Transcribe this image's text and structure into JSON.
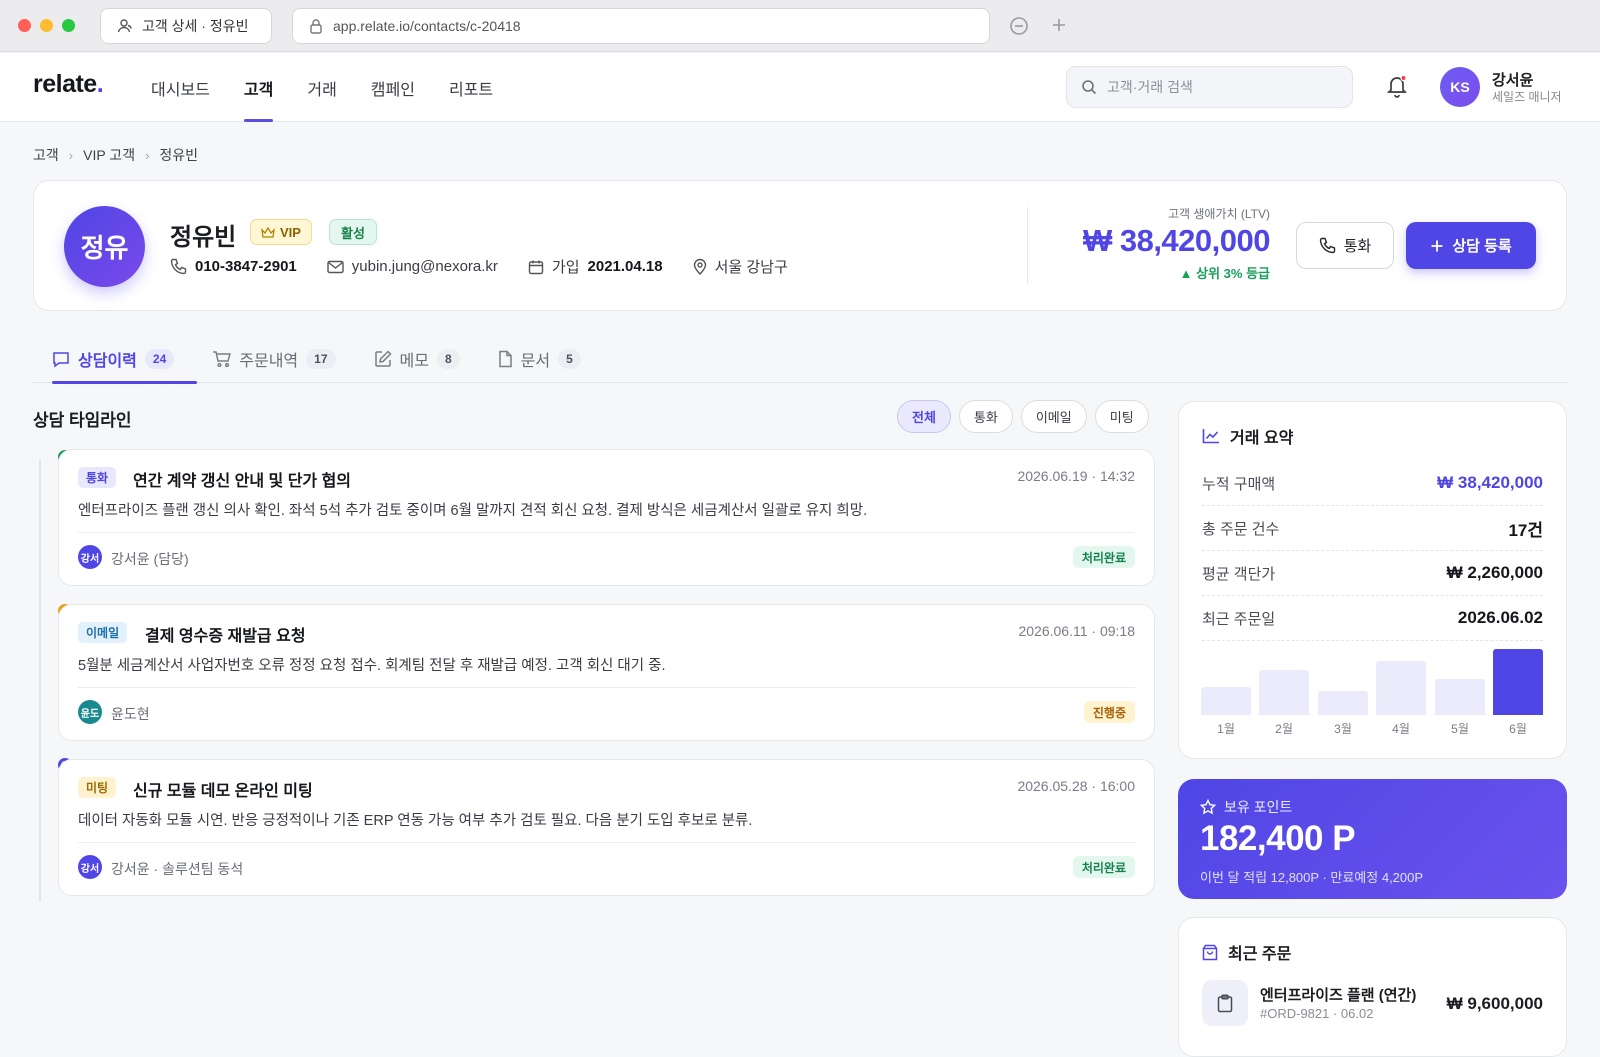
{
  "browser": {
    "tab_title": "고객 상세 · 정유빈",
    "url": "app.relate.io/contacts/c-20418"
  },
  "header": {
    "logo": "relate",
    "logo_dot": ".",
    "nav": [
      "대시보드",
      "고객",
      "거래",
      "캠페인",
      "리포트"
    ],
    "active_nav": "고객",
    "search_placeholder": "고객·거래 검색",
    "user": {
      "initials": "KS",
      "name": "강서윤",
      "role": "세일즈 매니저"
    }
  },
  "breadcrumb": [
    "고객",
    "VIP 고객",
    "정유빈"
  ],
  "profile": {
    "avatar": "정유",
    "name": "정유빈",
    "vip_badge": "VIP",
    "status_badge": "활성",
    "phone": "010-3847-2901",
    "email": "yubin.jung@nexora.kr",
    "join_label": "가입",
    "join_date": "2021.04.18",
    "location": "서울 강남구",
    "ltv_label": "고객 생애가치 (LTV)",
    "ltv_value": "₩ 38,420,000",
    "ltv_rank": "▲ 상위 3% 등급",
    "call_button": "통화",
    "add_button": "상담 등록"
  },
  "tabs": [
    {
      "label": "상담이력",
      "count": "24"
    },
    {
      "label": "주문내역",
      "count": "17"
    },
    {
      "label": "메모",
      "count": "8"
    },
    {
      "label": "문서",
      "count": "5"
    }
  ],
  "timeline": {
    "title": "상담 타임라인",
    "filters": [
      "전체",
      "통화",
      "이메일",
      "미팅"
    ],
    "entries": [
      {
        "type": "통화",
        "title": "연간 계약 갱신 안내 및 단가 협의",
        "date": "2026.06.19 · 14:32",
        "body": "엔터프라이즈 플랜 갱신 의사 확인. 좌석 5석 추가 검토 중이며 6월 말까지 견적 회신 요청. 결제 방식은 세금계산서 일괄로 유지 희망.",
        "avatar": "강서",
        "who": "강서윤 (담당)",
        "status": "처리완료"
      },
      {
        "type": "이메일",
        "title": "결제 영수증 재발급 요청",
        "date": "2026.06.11 · 09:18",
        "body": "5월분 세금계산서 사업자번호 오류 정정 요청 접수. 회계팀 전달 후 재발급 예정. 고객 회신 대기 중.",
        "avatar": "윤도",
        "who": "윤도현",
        "status": "진행중"
      },
      {
        "type": "미팅",
        "title": "신규 모듈 데모 온라인 미팅",
        "date": "2026.05.28 · 16:00",
        "body": "데이터 자동화 모듈 시연. 반응 긍정적이나 기존 ERP 연동 가능 여부 추가 검토 필요. 다음 분기 도입 후보로 분류.",
        "avatar": "강서",
        "who": "강서윤 · 솔루션팀 동석",
        "status": "처리완료"
      }
    ]
  },
  "summary": {
    "title": "거래 요약",
    "rows": [
      {
        "label": "누적 구매액",
        "value": "₩ 38,420,000"
      },
      {
        "label": "총 주문 건수",
        "value": "17건"
      },
      {
        "label": "평균 객단가",
        "value": "₩ 2,260,000"
      },
      {
        "label": "최근 주문일",
        "value": "2026.06.02"
      }
    ],
    "chart_data": {
      "type": "bar",
      "categories": [
        "1월",
        "2월",
        "3월",
        "4월",
        "5월",
        "6월"
      ],
      "values": [
        27,
        44,
        23,
        52,
        35,
        64
      ],
      "highlight": "6월"
    }
  },
  "points": {
    "label": "보유 포인트",
    "value": "182,400 P",
    "sub": "이번 달 적립 12,800P · 만료예정 4,200P"
  },
  "recent_orders": {
    "title": "최근 주문",
    "items": [
      {
        "name": "엔터프라이즈 플랜 (연간)",
        "meta": "#ORD-9821 · 06.02",
        "price": "₩ 9,600,000"
      }
    ]
  },
  "colors": {
    "accent": "#4f46e5",
    "success": "#17a05a",
    "call_type_bg": "#e9e7fc",
    "email_type_bg": "#e2f1fb",
    "meeting_type_bg": "#fff3cf"
  }
}
